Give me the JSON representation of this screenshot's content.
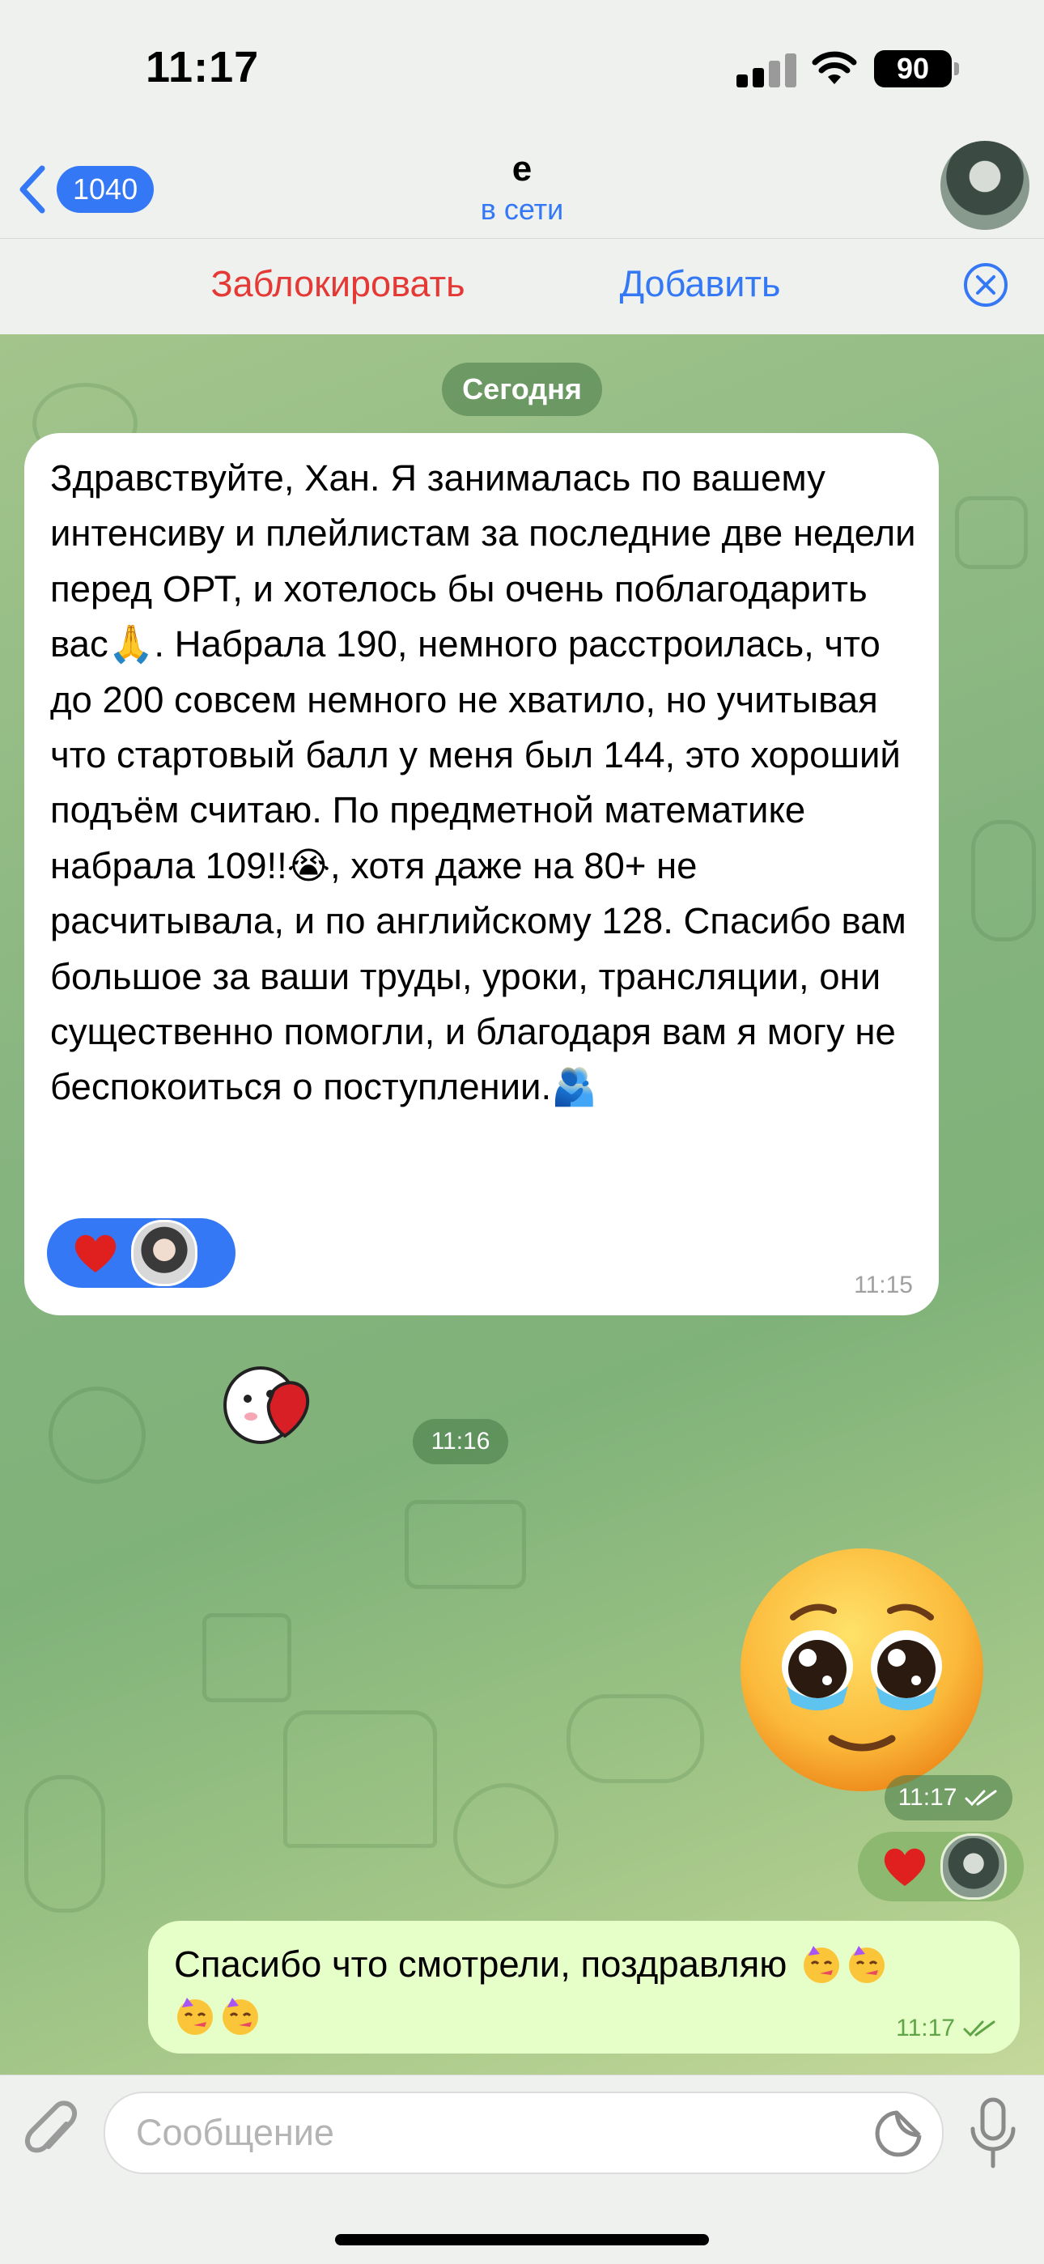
{
  "status_bar": {
    "time": "11:17",
    "battery": "90"
  },
  "header": {
    "back_count": "1040",
    "contact_name": "e",
    "contact_status": "в сети"
  },
  "action_bar": {
    "block_label": "Заблокировать",
    "add_label": "Добавить"
  },
  "chat": {
    "date_label": "Сегодня",
    "incoming_message": {
      "text": "Здравствуйте, Хан. Я занималась по вашему интенсиву и плейлистам за последние две недели перед ОРТ, и хотелось бы очень поблагодарить вас🙏. Набрала 190, немного расстроилась, что до 200 совсем немного не хватило, но учитывая что стартовый балл у меня был 144, это хороший подъём считаю. По предметной математике набрала 109!!😭, хотя даже на 80+ не расчитывала, и по английскому 128. Спасибо вам большое за ваши труды, уроки, трансляции, они существенно помогли, и благодаря вам я могу не беспокоиться о поступлении.🫂",
      "time": "11:15",
      "reaction": "heart"
    },
    "sticker_message": {
      "time": "11:16"
    },
    "emoji_message": {
      "time": "11:17"
    },
    "outgoing_message": {
      "text": "Спасибо что смотрели, поздравляю",
      "time": "11:17",
      "reaction": "heart"
    }
  },
  "input": {
    "placeholder": "Сообщение"
  },
  "colors": {
    "accent": "#3478f6",
    "block_red": "#e53935",
    "outgoing_bubble": "#e6ffc8",
    "read_check": "#5fa548"
  },
  "icons": [
    "chevron-left-icon",
    "signal-icon",
    "wifi-icon",
    "battery-icon",
    "close-circle-icon",
    "heart-icon",
    "paperclip-icon",
    "sticker-icon",
    "microphone-icon",
    "double-check-icon",
    "pleading-face-emoji",
    "partying-face-emoji"
  ]
}
